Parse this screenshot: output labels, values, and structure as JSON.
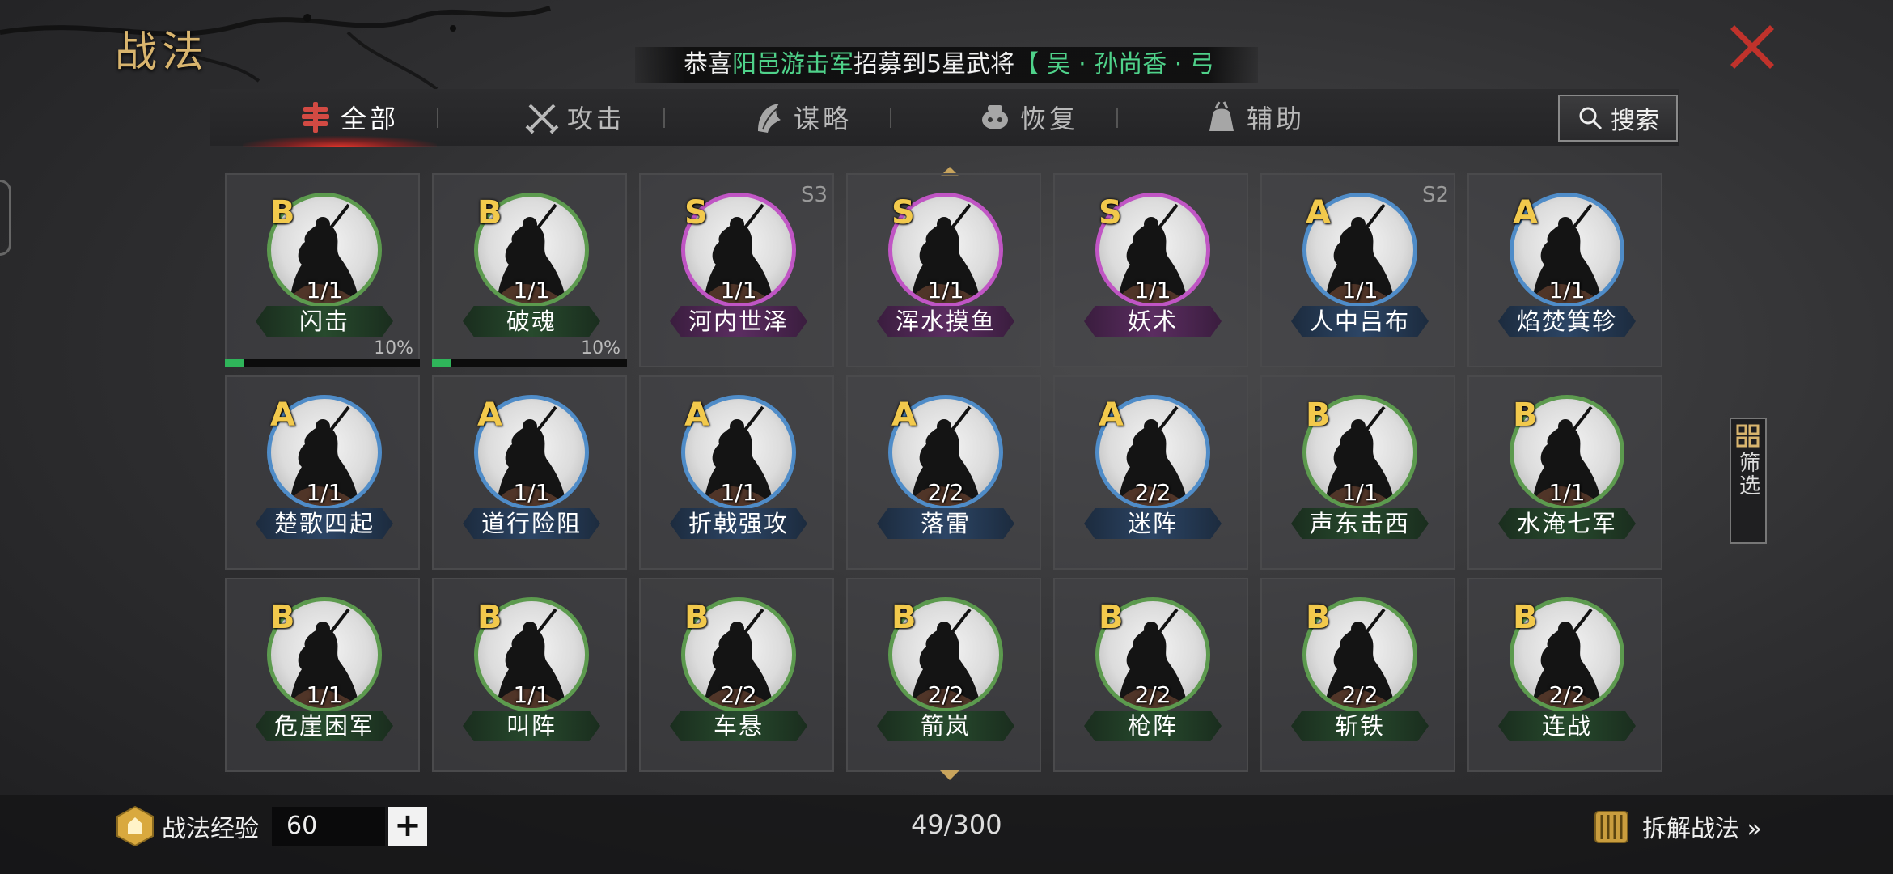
{
  "page": {
    "title": "战法"
  },
  "ticker": {
    "prefix": "恭喜",
    "highlight": "阳邑游击军",
    "middle": "招募到5星武将",
    "tail": "【 吴 · 孙尚香 · 弓"
  },
  "tabs": [
    {
      "label": "全部",
      "icon": "all-skills-icon",
      "active": true
    },
    {
      "label": "攻击",
      "icon": "crossed-swords-icon",
      "active": false
    },
    {
      "label": "谋略",
      "icon": "strategy-icon",
      "active": false
    },
    {
      "label": "恢复",
      "icon": "recover-icon",
      "active": false
    },
    {
      "label": "辅助",
      "icon": "support-icon",
      "active": false
    }
  ],
  "search": {
    "label": "搜索"
  },
  "filter": {
    "label": "筛选"
  },
  "colors": {
    "grade_S": "#c055c4",
    "grade_A": "#4f8cc8",
    "grade_B": "#5c9a4e",
    "progress": "#2fb55a",
    "accent_gold": "#d9b56e",
    "ticker_green": "#4fd28a"
  },
  "skills": [
    {
      "grade": "B",
      "name": "闪击",
      "count": "1/1",
      "season": "",
      "progress": "10%",
      "progress_value": 0.1
    },
    {
      "grade": "B",
      "name": "破魂",
      "count": "1/1",
      "season": "",
      "progress": "10%",
      "progress_value": 0.1
    },
    {
      "grade": "S",
      "name": "河内世泽",
      "count": "1/1",
      "season": "S3",
      "progress": ""
    },
    {
      "grade": "S",
      "name": "浑水摸鱼",
      "count": "1/1",
      "season": "",
      "progress": ""
    },
    {
      "grade": "S",
      "name": "妖术",
      "count": "1/1",
      "season": "",
      "progress": ""
    },
    {
      "grade": "A",
      "name": "人中吕布",
      "count": "1/1",
      "season": "S2",
      "progress": ""
    },
    {
      "grade": "A",
      "name": "焰焚箕轸",
      "count": "1/1",
      "season": "",
      "progress": ""
    },
    {
      "grade": "A",
      "name": "楚歌四起",
      "count": "1/1",
      "season": "",
      "progress": ""
    },
    {
      "grade": "A",
      "name": "道行险阻",
      "count": "1/1",
      "season": "",
      "progress": ""
    },
    {
      "grade": "A",
      "name": "折戟强攻",
      "count": "1/1",
      "season": "",
      "progress": ""
    },
    {
      "grade": "A",
      "name": "落雷",
      "count": "2/2",
      "season": "",
      "progress": ""
    },
    {
      "grade": "A",
      "name": "迷阵",
      "count": "2/2",
      "season": "",
      "progress": ""
    },
    {
      "grade": "B",
      "name": "声东击西",
      "count": "1/1",
      "season": "",
      "progress": ""
    },
    {
      "grade": "B",
      "name": "水淹七军",
      "count": "1/1",
      "season": "",
      "progress": ""
    },
    {
      "grade": "B",
      "name": "危崖困军",
      "count": "1/1",
      "season": "",
      "progress": ""
    },
    {
      "grade": "B",
      "name": "叫阵",
      "count": "1/1",
      "season": "",
      "progress": ""
    },
    {
      "grade": "B",
      "name": "车悬",
      "count": "2/2",
      "season": "",
      "progress": ""
    },
    {
      "grade": "B",
      "name": "箭岚",
      "count": "2/2",
      "season": "",
      "progress": ""
    },
    {
      "grade": "B",
      "name": "枪阵",
      "count": "2/2",
      "season": "",
      "progress": ""
    },
    {
      "grade": "B",
      "name": "斩铁",
      "count": "2/2",
      "season": "",
      "progress": ""
    },
    {
      "grade": "B",
      "name": "连战",
      "count": "2/2",
      "season": "",
      "progress": ""
    }
  ],
  "bottom": {
    "exp_label": "战法经验",
    "exp_value": "60",
    "plus_label": "+",
    "slot_count": "49/300",
    "decompose_label": "拆解战法 »"
  }
}
